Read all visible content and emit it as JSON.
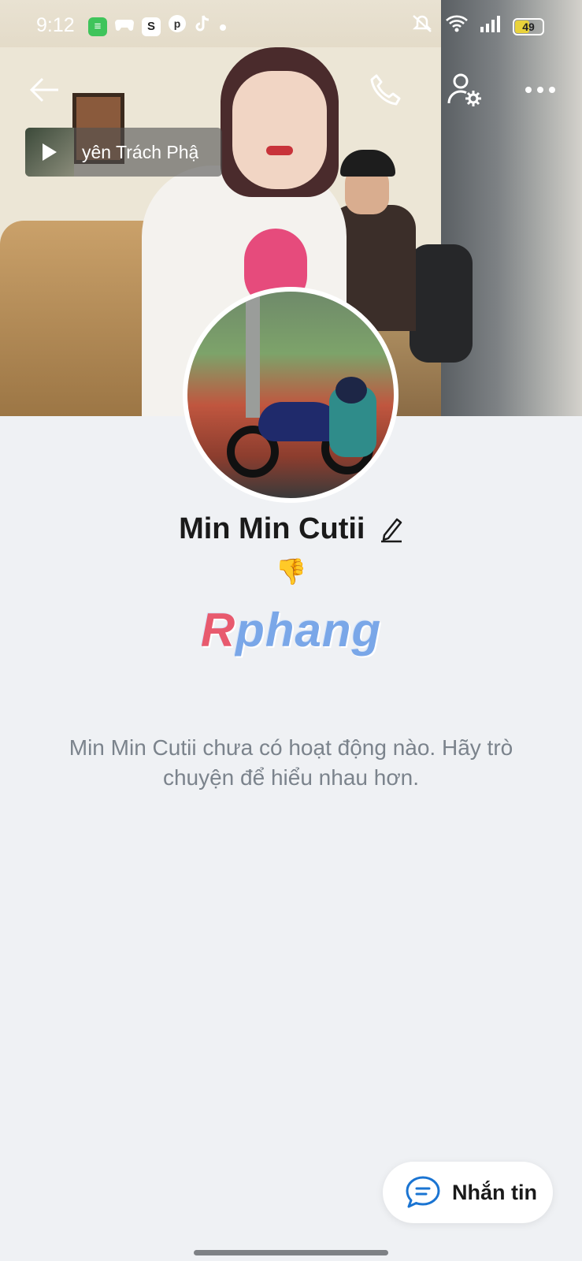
{
  "status_bar": {
    "time": "9:12",
    "battery": "49",
    "app_icons": [
      "messages-icon",
      "gamepad-icon",
      "shopee-icon",
      "pinterest-icon",
      "tiktok-icon",
      "dot-icon"
    ],
    "right_icons": [
      "silent-icon",
      "wifi-icon",
      "signal-icon",
      "battery-icon"
    ]
  },
  "header": {
    "icons": [
      "back-arrow-icon",
      "phone-icon",
      "user-settings-icon",
      "more-icon"
    ]
  },
  "music": {
    "title": "yên Trách Phậ"
  },
  "profile": {
    "name": "Min Min Cutii",
    "status_emoji": "👎",
    "watermark_r": "R",
    "watermark_rest": "phang"
  },
  "empty_state": {
    "message": "Min Min Cutii chưa có hoạt động nào. Hãy trò chuyện để hiểu nhau hơn."
  },
  "actions": {
    "message_label": "Nhắn tin"
  },
  "colors": {
    "background": "#eff1f4",
    "accent": "#1a74d2",
    "muted_text": "#7b838c"
  }
}
